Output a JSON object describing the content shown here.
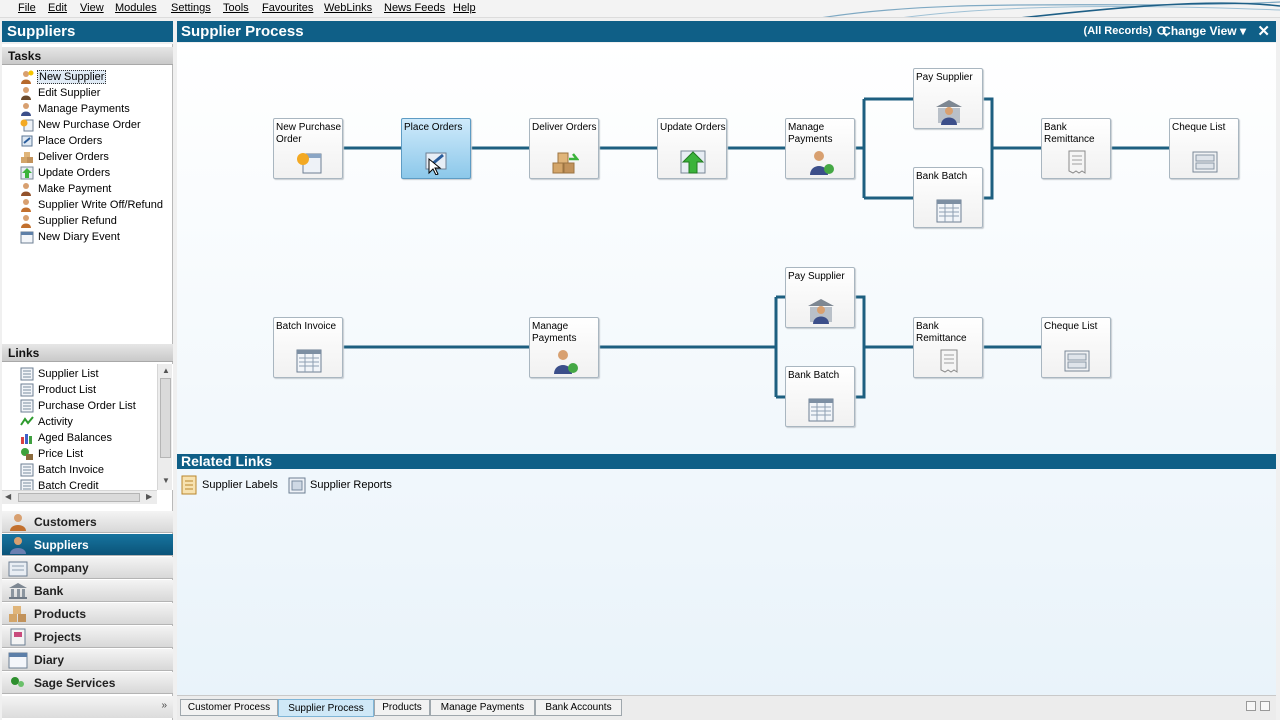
{
  "menu": [
    "File",
    "Edit",
    "View",
    "Modules",
    "Settings",
    "Tools",
    "Favourites",
    "WebLinks",
    "News Feeds",
    "Help"
  ],
  "left_title": "Suppliers",
  "tasks_header": "Tasks",
  "tasks": [
    {
      "label": "New Supplier",
      "icon": "person-new-icon"
    },
    {
      "label": "Edit Supplier",
      "icon": "person-edit-icon"
    },
    {
      "label": "Manage Payments",
      "icon": "person-payment-icon"
    },
    {
      "label": "New Purchase Order",
      "icon": "purchase-order-icon"
    },
    {
      "label": "Place Orders",
      "icon": "place-orders-icon"
    },
    {
      "label": "Deliver Orders",
      "icon": "deliver-orders-icon"
    },
    {
      "label": "Update Orders",
      "icon": "update-orders-icon"
    },
    {
      "label": "Make Payment",
      "icon": "make-payment-icon"
    },
    {
      "label": "Supplier Write Off/Refund",
      "icon": "write-off-icon"
    },
    {
      "label": "Supplier Refund",
      "icon": "refund-icon"
    },
    {
      "label": "New Diary Event",
      "icon": "diary-event-icon"
    }
  ],
  "links_header": "Links",
  "links": [
    {
      "label": "Supplier List",
      "icon": "list-icon"
    },
    {
      "label": "Product List",
      "icon": "list-icon"
    },
    {
      "label": "Purchase Order List",
      "icon": "list-icon"
    },
    {
      "label": "Activity",
      "icon": "activity-icon"
    },
    {
      "label": "Aged Balances",
      "icon": "bar-chart-icon"
    },
    {
      "label": "Price List",
      "icon": "price-list-icon"
    },
    {
      "label": "Batch Invoice",
      "icon": "list-icon"
    },
    {
      "label": "Batch Credit",
      "icon": "list-icon"
    }
  ],
  "nav": [
    {
      "label": "Customers",
      "icon": "customers-icon"
    },
    {
      "label": "Suppliers",
      "icon": "suppliers-icon",
      "active": true
    },
    {
      "label": "Company",
      "icon": "company-icon"
    },
    {
      "label": "Bank",
      "icon": "bank-icon"
    },
    {
      "label": "Products",
      "icon": "products-icon"
    },
    {
      "label": "Projects",
      "icon": "projects-icon"
    },
    {
      "label": "Diary",
      "icon": "diary-icon"
    },
    {
      "label": "Sage Services",
      "icon": "sage-services-icon"
    }
  ],
  "main": {
    "title": "Supplier Process",
    "records": "(All Records)",
    "change_view": "Change View ▾",
    "close": "✕"
  },
  "flow1": {
    "new_purchase_order": "New Purchase Order",
    "place_orders": "Place Orders",
    "deliver_orders": "Deliver Orders",
    "update_orders": "Update Orders",
    "manage_payments": "Manage Payments",
    "pay_supplier": "Pay Supplier",
    "bank_batch": "Bank Batch",
    "bank_remittance": "Bank Remittance",
    "cheque_list": "Cheque List"
  },
  "flow2": {
    "batch_invoice": "Batch Invoice",
    "manage_payments": "Manage Payments",
    "pay_supplier": "Pay Supplier",
    "bank_batch": "Bank Batch",
    "bank_remittance": "Bank Remittance",
    "cheque_list": "Cheque List"
  },
  "related": {
    "header": "Related Links",
    "items": [
      "Supplier Labels",
      "Supplier Reports"
    ]
  },
  "tabs": [
    "Customer Process",
    "Supplier Process",
    "Products",
    "Manage Payments",
    "Bank Accounts"
  ],
  "active_tab": "Supplier Process",
  "colors": {
    "accent": "#0f5f87",
    "connector": "#1d5f80",
    "selected": "#8cc8ea"
  }
}
